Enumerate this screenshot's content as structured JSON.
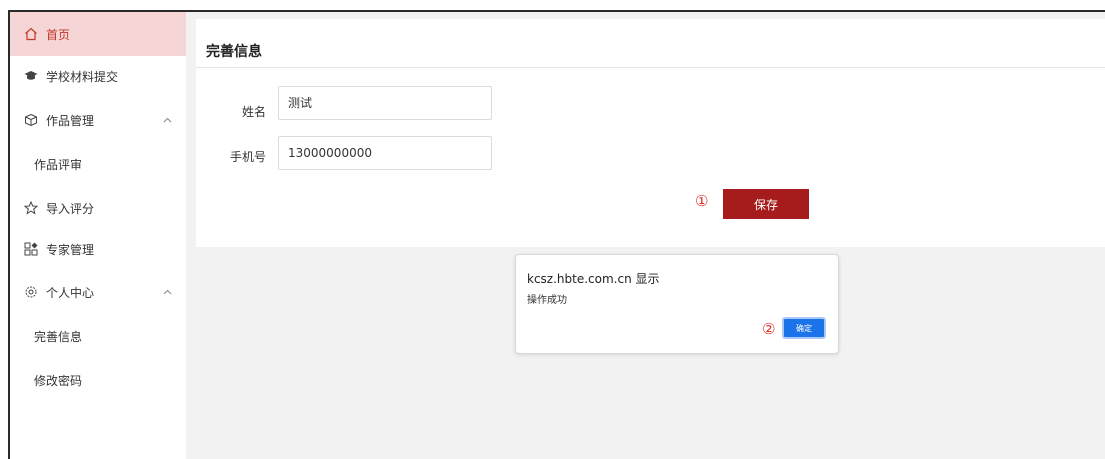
{
  "sidebar": {
    "items": [
      {
        "label": "首页",
        "icon": "home-icon"
      },
      {
        "label": "学校材料提交",
        "icon": "graduation-cap-icon"
      },
      {
        "label": "作品管理",
        "icon": "cube-icon"
      },
      {
        "label": "作品评审",
        "icon": ""
      },
      {
        "label": "导入评分",
        "icon": "star-outline-icon"
      },
      {
        "label": "专家管理",
        "icon": "grid-icon"
      },
      {
        "label": "个人中心",
        "icon": "gear-icon"
      },
      {
        "label": "完善信息",
        "icon": ""
      },
      {
        "label": "修改密码",
        "icon": ""
      }
    ]
  },
  "main": {
    "title": "完善信息",
    "form": {
      "name_label": "姓名",
      "name_value": "测试",
      "phone_label": "手机号",
      "phone_value": "13000000000"
    },
    "save_label": "保存",
    "marker_save": "①"
  },
  "dialog": {
    "origin": "kcsz.hbte.com.cn 显示",
    "message": "操作成功",
    "ok_label": "确定",
    "marker_ok": "②"
  },
  "colors": {
    "accent": "#a61c1c",
    "active_bg": "#f5d5d5",
    "marker": "#e0302b",
    "dialog_button": "#1a73e8"
  }
}
